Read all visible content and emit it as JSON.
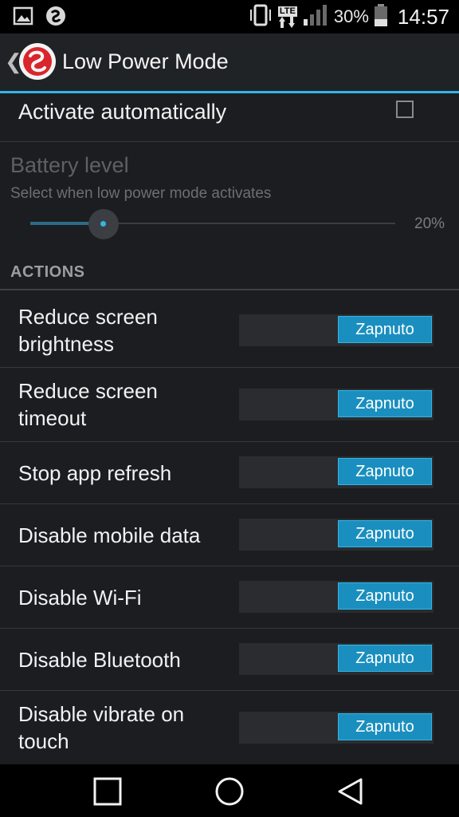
{
  "status_bar": {
    "left_icons": [
      "image-icon",
      "app-notification-icon"
    ],
    "right_icons": [
      "vibrate-icon",
      "lte-data-icon",
      "signal-icon",
      "battery-icon"
    ],
    "network_label": "LTE",
    "battery_percent": "30%",
    "time": "14:57"
  },
  "action_bar": {
    "back_icon": "chevron-left-icon",
    "logo": "qualcomm-logo",
    "title": "Low Power Mode"
  },
  "activate": {
    "label": "Activate automatically",
    "checked": false
  },
  "battery_level": {
    "title": "Battery level",
    "summary": "Select when low power mode activates",
    "value_label": "20%",
    "value_fraction": 0.2,
    "enabled": false
  },
  "actions": {
    "header": "ACTIONS",
    "items": [
      {
        "label": "Reduce screen brightness",
        "switch_label": "Zapnuto"
      },
      {
        "label": "Reduce screen timeout",
        "switch_label": "Zapnuto"
      },
      {
        "label": "Stop app refresh",
        "switch_label": "Zapnuto"
      },
      {
        "label": "Disable mobile data",
        "switch_label": "Zapnuto"
      },
      {
        "label": "Disable Wi-Fi",
        "switch_label": "Zapnuto"
      },
      {
        "label": "Disable Bluetooth",
        "switch_label": "Zapnuto"
      },
      {
        "label": "Disable vibrate on touch",
        "switch_label": "Zapnuto"
      }
    ]
  },
  "nav_bar": {
    "icons": [
      "recents-square-icon",
      "home-circle-icon",
      "back-triangle-icon"
    ]
  },
  "colors": {
    "accent": "#33b5e5",
    "switch_on": "#1a8fbf",
    "background": "#1b1d20"
  }
}
